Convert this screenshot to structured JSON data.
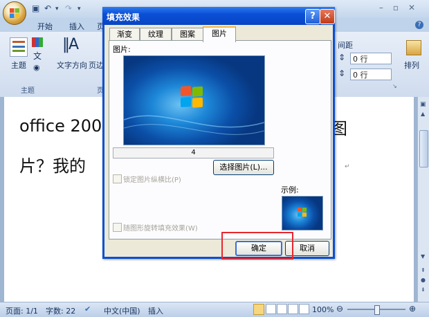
{
  "app": {
    "tabs": [
      "开始",
      "插入",
      "页"
    ],
    "ribbon": {
      "theme_group_button": "主题",
      "theme_group_label": "主题",
      "text_direction_label": "文字方向",
      "margin_label": "页边",
      "spacing_header": "间距",
      "spacing_before": "0 行",
      "spacing_after": "0 行",
      "arrange_label": "排列",
      "page_group_label": "页"
    },
    "document": {
      "line1_left": "office 200",
      "line1_right": "图",
      "line2_left": "片？我的",
      "return_mark": "↵"
    },
    "status": {
      "page": "页面: 1/1",
      "words": "字数: 22",
      "language": "中文(中国)",
      "mode": "插入",
      "zoom": "100%",
      "zoom_level": 100
    }
  },
  "dialog": {
    "title": "填充效果",
    "tabs": [
      "渐变",
      "纹理",
      "图案",
      "图片"
    ],
    "active_tab": "图片",
    "picture_label": "图片:",
    "picture_caption": "4",
    "select_picture_button": "选择图片(L)...",
    "lock_aspect_checkbox": "锁定图片纵横比(P)",
    "rotate_with_shape_checkbox": "随图形旋转填充效果(W)",
    "sample_label": "示例:",
    "ok_button": "确定",
    "cancel_button": "取消",
    "help_button": "?",
    "close_button": "✕"
  },
  "colors": {
    "dialog_title_blue": "#0a4fd6",
    "highlight_red": "#e8262e",
    "dialog_face": "#ece9d8"
  }
}
